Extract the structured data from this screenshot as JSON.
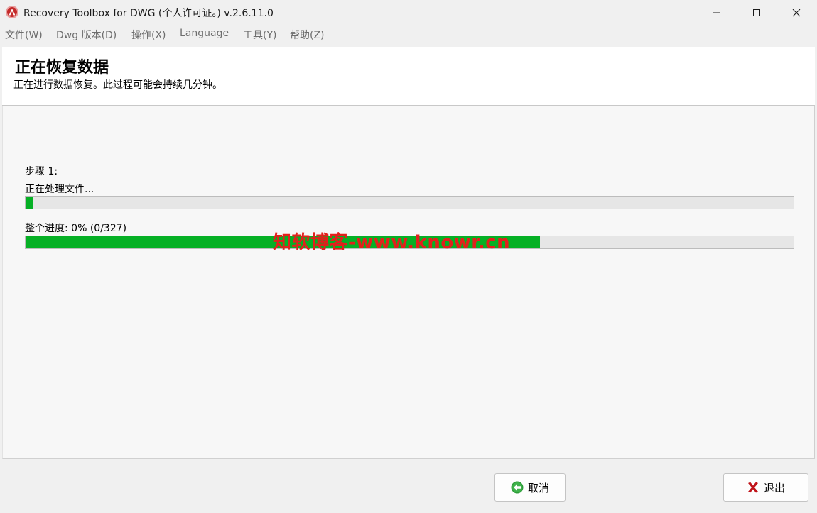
{
  "window": {
    "title": "Recovery Toolbox for DWG (个人许可证。) v.2.6.11.0",
    "app_icon": "recovery-toolbox-logo-icon"
  },
  "menu": {
    "items": [
      {
        "label": "文件(W)"
      },
      {
        "label": "Dwg 版本(D)"
      },
      {
        "label": "操作(X)"
      },
      {
        "label": "Language"
      },
      {
        "label": "工具(Y)"
      },
      {
        "label": "帮助(Z)"
      }
    ]
  },
  "header": {
    "title": "正在恢复数据",
    "subtitle": "正在进行数据恢复。此过程可能会持续几分钟。"
  },
  "progress": {
    "step_label": "步骤 1:",
    "step_status": "正在处理文件...",
    "step_progress": 0.01,
    "overall_label": "整个进度: 0% (0/327)",
    "overall_progress": 0.67
  },
  "watermark": "知软博客-www.knowr.cn",
  "buttons": {
    "cancel": "取消",
    "exit": "退出"
  },
  "colors": {
    "progress_fill": "#06b025",
    "watermark": "#e2201c",
    "exit_icon": "#c0141a",
    "cancel_icon": "#2e9d3a"
  }
}
